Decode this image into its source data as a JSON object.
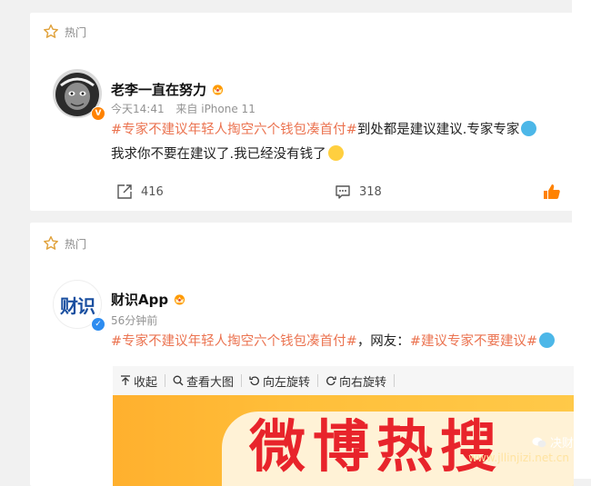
{
  "posts": [
    {
      "hot_label": "热门",
      "author": "老李一直在努力",
      "time": "今天14:41",
      "source": "来自 iPhone 11",
      "line1": {
        "tag": "#专家不建议年轻人掏空六个钱包凑首付#",
        "text": "到处都是建议建议.专家专家"
      },
      "line2": "我求你不要在建议了.我已经没有钱了",
      "repost_count": "416",
      "comment_count": "318"
    },
    {
      "hot_label": "热门",
      "author": "财识App",
      "avatar_text": "财识",
      "time": "56分钟前",
      "line1": {
        "tag1": "#专家不建议年轻人掏空六个钱包凑首付#",
        "text": "，网友：",
        "tag2": "#建议专家不要建议#"
      },
      "toolbar": [
        "收起",
        "查看大图",
        "向左旋转",
        "向右旋转"
      ],
      "banner_text": "微博热搜"
    }
  ],
  "watermark": {
    "name": "决财局",
    "url": "www.jllinjizi.net.cn"
  },
  "icons": [
    "star-icon",
    "vip-crown-icon",
    "verified-icon",
    "share-icon",
    "comment-icon",
    "like-icon",
    "emoji-face-icon",
    "rotate-left-icon",
    "rotate-right-icon",
    "search-icon",
    "collapse-icon"
  ],
  "colors": {
    "tag": "#eb7350",
    "verified": "#ff8200",
    "verified_blue": "#2d8cf0",
    "background": "#f1f1f1",
    "like": "#ff8200"
  }
}
